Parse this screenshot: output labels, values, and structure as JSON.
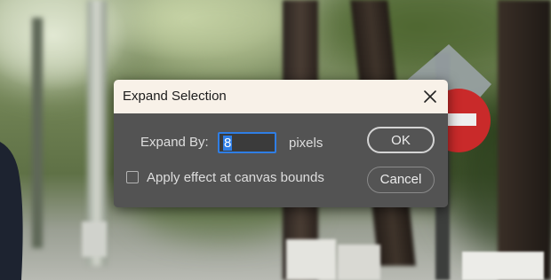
{
  "dialog": {
    "title": "Expand Selection",
    "close_icon": "close-icon",
    "expand_by_label": "Expand By:",
    "expand_by_value": "8",
    "unit_label": "pixels",
    "canvas_bounds_label": "Apply effect at canvas bounds",
    "canvas_bounds_checked": false,
    "ok_label": "OK",
    "cancel_label": "Cancel"
  },
  "colors": {
    "titlebar": "#f8f1e8",
    "body": "#535353",
    "focus_accent": "#2f7ee5",
    "text": "#dedede"
  }
}
